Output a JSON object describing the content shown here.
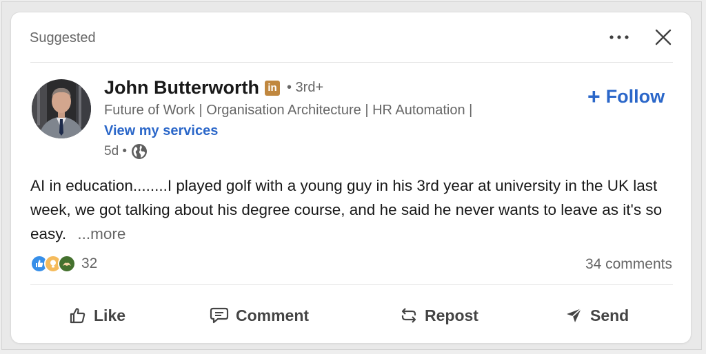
{
  "header": {
    "label": "Suggested"
  },
  "author": {
    "name": "John Butterworth",
    "badge": "in",
    "degree": "• 3rd+",
    "headline": "Future of Work | Organisation Architecture | HR Automation |",
    "services_link": "View my services",
    "time": "5d •"
  },
  "follow_label": "Follow",
  "post": {
    "text": "AI in education........I played golf with a young guy in his 3rd year at university in the UK last week, we got talking about his degree course, and he said he never wants to leave as it's so easy.",
    "see_more": "...more"
  },
  "social": {
    "reaction_icons": [
      "like-icon",
      "insightful-icon",
      "support-icon"
    ],
    "reaction_count": "32",
    "comments": "34 comments"
  },
  "actions": {
    "like": "Like",
    "comment": "Comment",
    "repost": "Repost",
    "send": "Send"
  },
  "colors": {
    "link_blue": "#2b67c9",
    "muted": "#666666",
    "linkedin_badge": "#c0873f"
  }
}
